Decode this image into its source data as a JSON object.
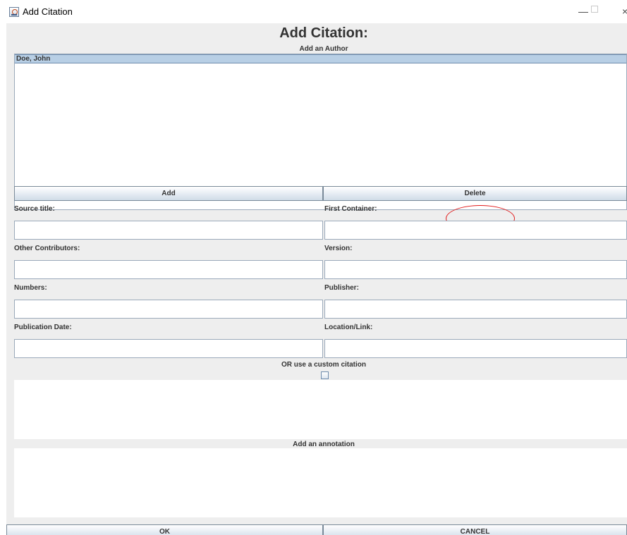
{
  "window": {
    "title": "Add Citation",
    "controls": {
      "minimize": "—",
      "close": "×"
    }
  },
  "dialog": {
    "heading": "Add Citation:",
    "author_section_label": "Add an Author",
    "authors": [
      "Doe, John"
    ],
    "selected_author_index": 0,
    "add_label": "Add",
    "delete_label": "Delete"
  },
  "fields": {
    "source_title": {
      "label": "Source title:",
      "value": ""
    },
    "first_container": {
      "label": "First Container:",
      "value": ""
    },
    "other_contributors": {
      "label": "Other Contributors:",
      "value": ""
    },
    "version": {
      "label": "Version:",
      "value": ""
    },
    "numbers": {
      "label": "Numbers:",
      "value": ""
    },
    "publisher": {
      "label": "Publisher:",
      "value": ""
    },
    "publication_date": {
      "label": "Publication Date:",
      "value": ""
    },
    "location_link": {
      "label": "Location/Link:",
      "value": ""
    }
  },
  "custom_citation": {
    "label": "OR use a custom citation",
    "checked": false,
    "value": ""
  },
  "annotation": {
    "label": "Add an annotation",
    "value": ""
  },
  "footer": {
    "ok_label": "OK",
    "cancel_label": "CANCEL"
  },
  "colors": {
    "selection": "#b8cfe5",
    "annotation_circle": "#e21c1c",
    "panel_background": "#eeeeee"
  }
}
